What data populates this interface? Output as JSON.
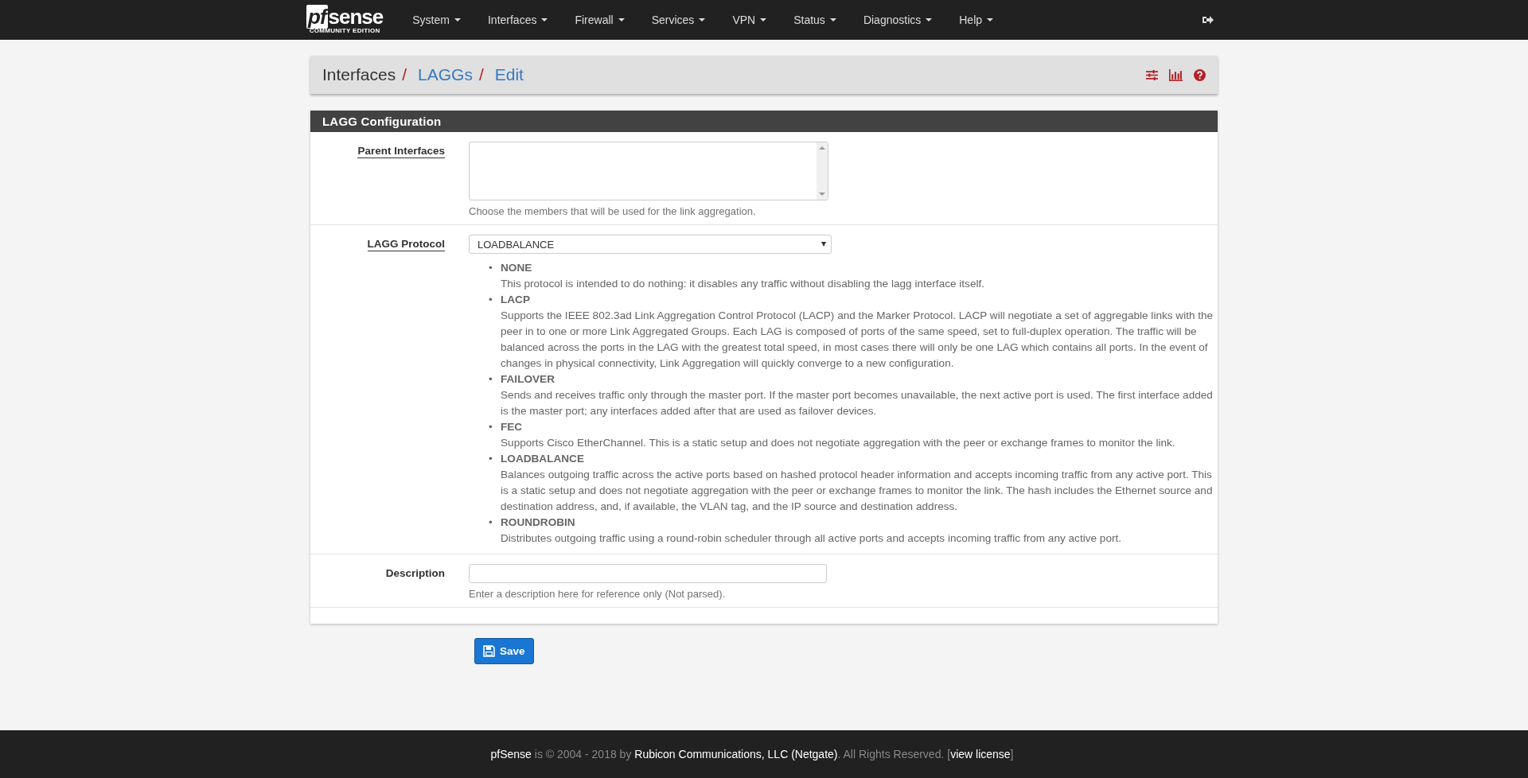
{
  "navbar": {
    "logo": "sense",
    "logo_prefix": "pf",
    "logo_sub": "COMMUNITY EDITION",
    "menus": [
      {
        "label": "System"
      },
      {
        "label": "Interfaces"
      },
      {
        "label": "Firewall"
      },
      {
        "label": "Services"
      },
      {
        "label": "VPN"
      },
      {
        "label": "Status"
      },
      {
        "label": "Diagnostics"
      },
      {
        "label": "Help"
      }
    ]
  },
  "breadcrumb": [
    {
      "label": "Interfaces",
      "kind": "text",
      "separator": "/"
    },
    {
      "label": "LAGGs",
      "kind": "link",
      "separator": "/"
    },
    {
      "label": "Edit",
      "kind": "link"
    }
  ],
  "panel": {
    "title": "LAGG Configuration",
    "parent_interfaces": {
      "label": "Parent Interfaces",
      "help": "Choose the members that will be used for the link aggregation."
    },
    "protocol": {
      "label": "LAGG Protocol",
      "value": "LOADBALANCE",
      "options": [
        {
          "marker": "•",
          "name": "NONE",
          "text": "This protocol is intended to do nothing: it disables any traffic without disabling the lagg interface itself."
        },
        {
          "marker": "•",
          "name": "LACP",
          "text": "Supports the IEEE 802.3ad Link Aggregation Control Protocol (LACP) and the Marker Protocol. LACP will negotiate a set of aggregable links with the peer in to one or more Link Aggregated Groups. Each LAG is composed of ports of the same speed, set to full-duplex operation. The traffic will be balanced across the ports in the LAG with the greatest total speed, in most cases there will only be one LAG which contains all ports. In the event of changes in physical connectivity, Link Aggregation will quickly converge to a new configuration."
        },
        {
          "marker": "•",
          "name": "FAILOVER",
          "text": "Sends and receives traffic only through the master port. If the master port becomes unavailable, the next active port is used. The first interface added is the master port; any interfaces added after that are used as failover devices."
        },
        {
          "marker": "•",
          "name": "FEC",
          "text": "Supports Cisco EtherChannel. This is a static setup and does not negotiate aggregation with the peer or exchange frames to monitor the link."
        },
        {
          "marker": "•",
          "name": "LOADBALANCE",
          "text": "Balances outgoing traffic across the active ports based on hashed protocol header information and accepts incoming traffic from any active port. This is a static setup and does not negotiate aggregation with the peer or exchange frames to monitor the link. The hash includes the Ethernet source and destination address, and, if available, the VLAN tag, and the IP source and destination address."
        },
        {
          "marker": "•",
          "name": "ROUNDROBIN",
          "text": "Distributes outgoing traffic using a round-robin scheduler through all active ports and accepts incoming traffic from any active port."
        }
      ]
    },
    "description": {
      "label": "Description",
      "help": "Enter a description here for reference only (Not parsed)."
    }
  },
  "save_button": "Save",
  "footer": "**pfSense** is © 2004 - 2018 by **Rubicon Communications, LLC (Netgate)**. All Rights Reserved. [**view license**]"
}
